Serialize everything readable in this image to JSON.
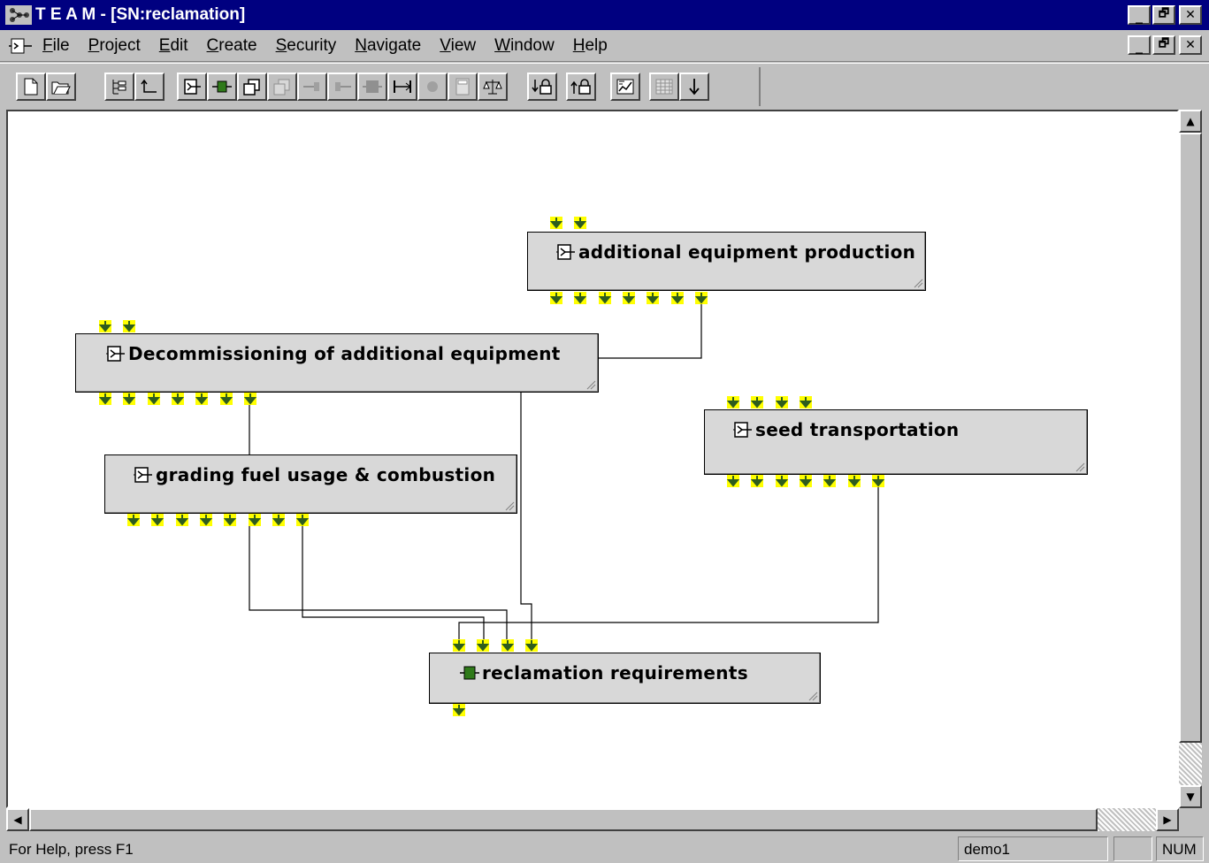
{
  "window": {
    "title": "T E A M - [SN:reclamation]",
    "min_glyph": "_",
    "max_glyph": "🗗",
    "close_glyph": "✕"
  },
  "menu": {
    "items": [
      {
        "label": "File",
        "underline": "F",
        "rest": "ile"
      },
      {
        "label": "Project",
        "underline": "P",
        "rest": "roject"
      },
      {
        "label": "Edit",
        "underline": "E",
        "rest": "dit"
      },
      {
        "label": "Create",
        "underline": "C",
        "rest": "reate"
      },
      {
        "label": "Security",
        "underline": "S",
        "rest": "ecurity"
      },
      {
        "label": "Navigate",
        "underline": "N",
        "rest": "avigate"
      },
      {
        "label": "View",
        "underline": "V",
        "rest": "iew"
      },
      {
        "label": "Window",
        "underline": "W",
        "rest": "indow"
      },
      {
        "label": "Help",
        "underline": "H",
        "rest": "elp"
      }
    ]
  },
  "toolbar": {
    "buttons": [
      {
        "name": "new-button",
        "icon": "new-document-icon",
        "enabled": true
      },
      {
        "name": "open-button",
        "icon": "open-folder-icon",
        "enabled": true
      },
      {
        "name": "tree-view-button",
        "icon": "tree-icon",
        "enabled": true
      },
      {
        "name": "go-up-button",
        "icon": "up-level-icon",
        "enabled": true
      },
      {
        "name": "create-process-button",
        "icon": "process-icon",
        "enabled": true
      },
      {
        "name": "create-flow-button",
        "icon": "flow-icon",
        "enabled": true
      },
      {
        "name": "copy-process-button",
        "icon": "copy-icon",
        "enabled": true
      },
      {
        "name": "paste-process-button",
        "icon": "paste-icon",
        "enabled": false
      },
      {
        "name": "input-button",
        "icon": "input-icon",
        "enabled": false
      },
      {
        "name": "output-button",
        "icon": "output-icon",
        "enabled": false
      },
      {
        "name": "block-button",
        "icon": "block-icon",
        "enabled": false
      },
      {
        "name": "link-button",
        "icon": "link-icon",
        "enabled": true
      },
      {
        "name": "node-button",
        "icon": "node-icon",
        "enabled": false
      },
      {
        "name": "calculator-button",
        "icon": "calculator-icon",
        "enabled": false
      },
      {
        "name": "balance-button",
        "icon": "balance-icon",
        "enabled": true
      },
      {
        "name": "lock-down-button",
        "icon": "lock-down-icon",
        "enabled": true
      },
      {
        "name": "lock-up-button",
        "icon": "lock-up-icon",
        "enabled": true
      },
      {
        "name": "chart-button",
        "icon": "chart-icon",
        "enabled": true
      },
      {
        "name": "grid-button",
        "icon": "grid-icon",
        "enabled": false
      },
      {
        "name": "download-button",
        "icon": "down-arrow-icon",
        "enabled": true
      }
    ]
  },
  "diagram": {
    "processes": [
      {
        "id": "additional-equipment-production",
        "label": "additional equipment production",
        "icon": "process-icon"
      },
      {
        "id": "decommissioning",
        "label": "Decommissioning of additional equipment",
        "icon": "process-icon"
      },
      {
        "id": "seed-transportation",
        "label": "seed transportation",
        "icon": "process-icon"
      },
      {
        "id": "grading-fuel",
        "label": "grading fuel usage & combustion",
        "icon": "process-icon"
      },
      {
        "id": "reclamation-requirements",
        "label": "reclamation requirements",
        "icon": "flow-icon"
      }
    ],
    "colors": {
      "arrow_fill": "#ffff00",
      "arrow_head": "#2e5d1e",
      "box_fill": "#d8d8d8",
      "flow_green": "#2f7a1a"
    }
  },
  "status": {
    "help_text": "For Help, press F1",
    "user": "demo1",
    "indicator": "",
    "num": "NUM"
  }
}
